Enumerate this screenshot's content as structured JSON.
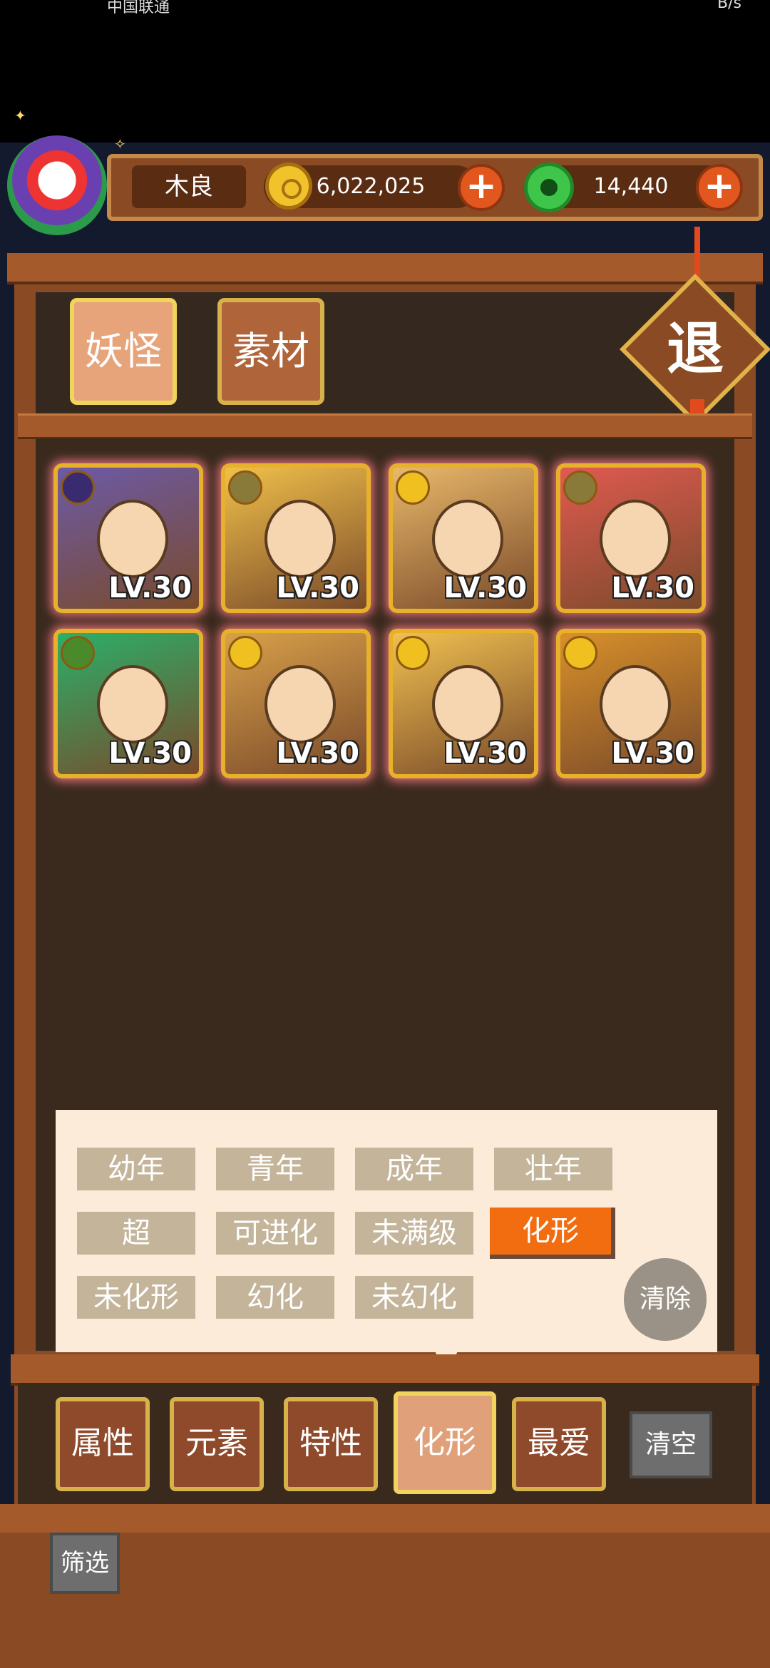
{
  "status_bar": {
    "left_text": "中国联通",
    "right_text": "B/s"
  },
  "player": {
    "name": "木良"
  },
  "resources": {
    "coins": "6,022,025",
    "gems": "14,440"
  },
  "top_tabs": [
    {
      "label": "妖怪",
      "active": true
    },
    {
      "label": "素材",
      "active": false
    }
  ],
  "exit_label": "退",
  "cards": [
    {
      "level": "LV.30",
      "element": "moon",
      "colors": {
        "bg": "#6c5aa8",
        "badge": "#3a2a70"
      }
    },
    {
      "level": "LV.30",
      "element": "earth",
      "colors": {
        "bg": "#f0c04a",
        "badge": "#8a7a3a"
      }
    },
    {
      "level": "LV.30",
      "element": "sun",
      "colors": {
        "bg": "#e8b86a",
        "badge": "#f0c020"
      }
    },
    {
      "level": "LV.30",
      "element": "earth",
      "colors": {
        "bg": "#e05a50",
        "badge": "#8a7a3a"
      }
    },
    {
      "level": "LV.30",
      "element": "wood",
      "colors": {
        "bg": "#2ab06a",
        "badge": "#4a8a2a"
      }
    },
    {
      "level": "LV.30",
      "element": "sun",
      "colors": {
        "bg": "#d8a04a",
        "badge": "#f0c020"
      }
    },
    {
      "level": "LV.30",
      "element": "sun",
      "colors": {
        "bg": "#f0c050",
        "badge": "#f0c020"
      }
    },
    {
      "level": "LV.30",
      "element": "sun",
      "colors": {
        "bg": "#d8902a",
        "badge": "#f0c020"
      }
    }
  ],
  "filters": {
    "row1": [
      "幼年",
      "青年",
      "成年",
      "壮年"
    ],
    "row2": [
      "超",
      "可进化",
      "未满级",
      "化形"
    ],
    "row3": [
      "未化形",
      "幻化",
      "未幻化"
    ],
    "selected": "化形",
    "clear_label": "清除"
  },
  "bottom_tabs": [
    {
      "label": "属性",
      "active": false
    },
    {
      "label": "元素",
      "active": false
    },
    {
      "label": "特性",
      "active": false
    },
    {
      "label": "化形",
      "active": true
    },
    {
      "label": "最爱",
      "active": false
    }
  ],
  "clear_all_label": "清空",
  "screen_label": "筛选",
  "accent_colors": {
    "wood": "#8a4a23",
    "gold": "#e8b12c",
    "selected": "#f26c10"
  }
}
